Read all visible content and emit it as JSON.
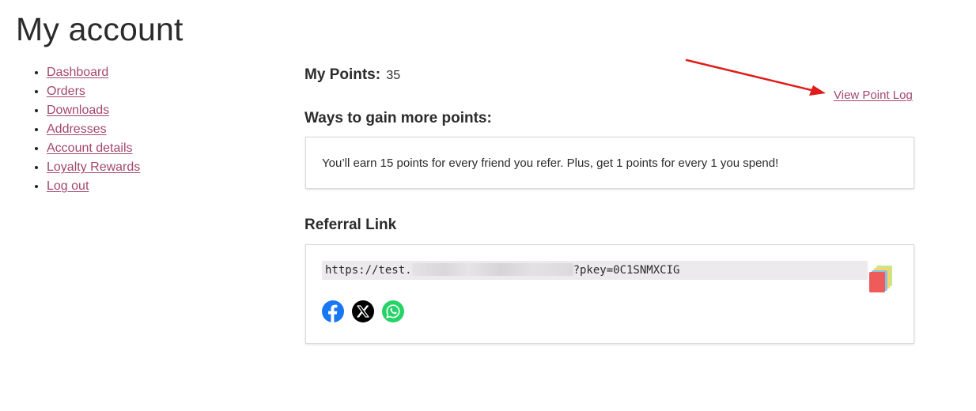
{
  "page": {
    "title": "My account"
  },
  "nav": {
    "items": [
      {
        "label": "Dashboard"
      },
      {
        "label": "Orders"
      },
      {
        "label": "Downloads"
      },
      {
        "label": "Addresses"
      },
      {
        "label": "Account details"
      },
      {
        "label": "Loyalty Rewards"
      },
      {
        "label": "Log out"
      }
    ]
  },
  "points": {
    "label": "My Points:",
    "value": "35",
    "view_log_label": "View Point Log"
  },
  "ways": {
    "heading": "Ways to gain more points:",
    "text": "You’ll earn 15 points for every friend you refer. Plus, get 1 points for every 1 you spend!"
  },
  "referral": {
    "heading": "Referral Link",
    "url_prefix": "https://test.",
    "url_suffix": "?pkey=0C1SNMXCIG"
  },
  "icons": {
    "copy": "copy-icon",
    "facebook": "facebook-icon",
    "x": "x-icon",
    "whatsapp": "whatsapp-icon"
  },
  "colors": {
    "link": "#a3476b",
    "annotation_arrow": "#e01b1b",
    "facebook": "#1877f2",
    "x": "#000000",
    "whatsapp": "#25d366"
  }
}
